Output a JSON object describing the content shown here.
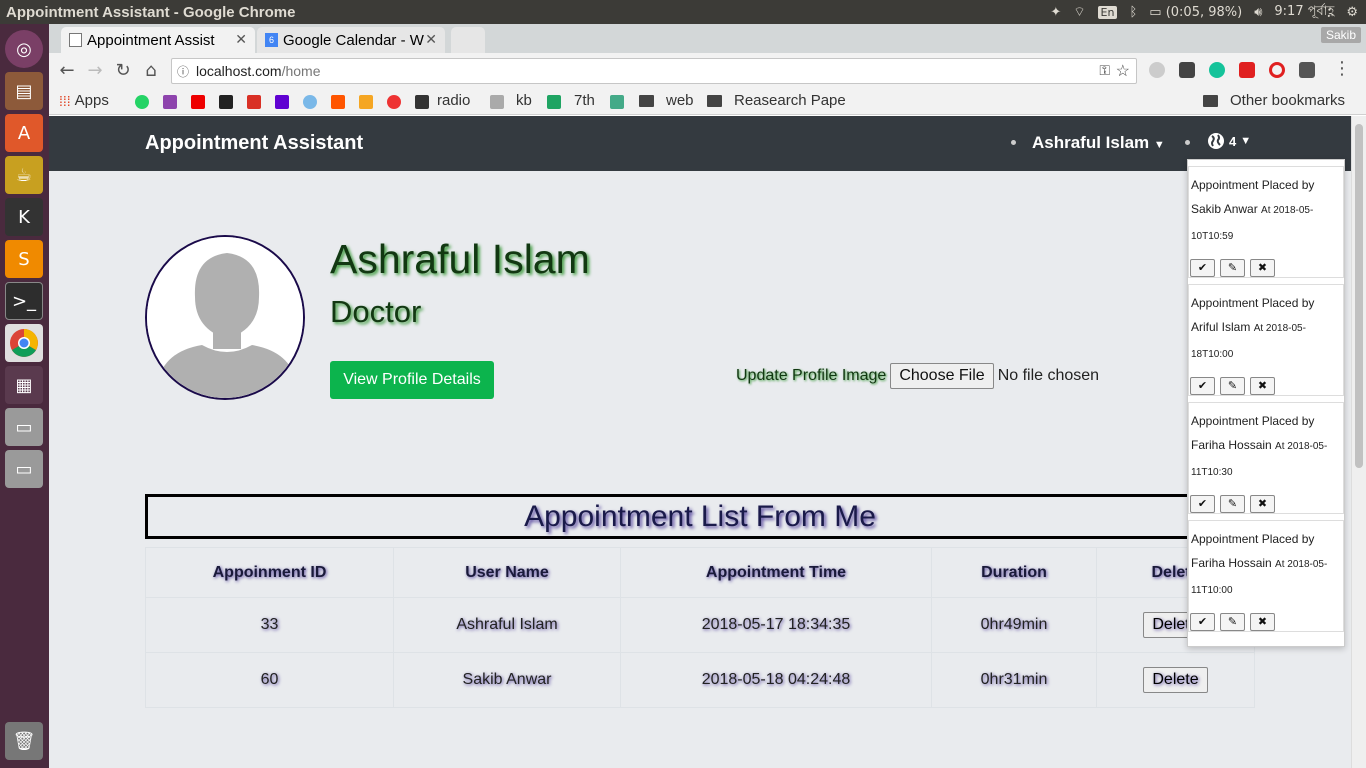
{
  "os": {
    "window_title": "Appointment Assistant - Google Chrome",
    "lang_indicator": "En",
    "battery": "(0:05, 98%)",
    "clock": "9:17 পূর্বাহ্ণ"
  },
  "browser": {
    "tabs": [
      {
        "label": "Appointment Assist"
      },
      {
        "label": "Google Calendar - W"
      }
    ],
    "user_chip": "Sakib",
    "url_host": "localhost.com",
    "url_path": "/home",
    "bookmarks": {
      "apps": "Apps",
      "radio": "radio",
      "kb": "kb",
      "seventh": "7th",
      "web": "web",
      "research": "Reasearch Pape",
      "other": "Other bookmarks"
    }
  },
  "navbar": {
    "brand": "Appointment Assistant",
    "user": "Ashraful Islam",
    "notif_count": "4"
  },
  "profile": {
    "name": "Ashraful Islam",
    "role": "Doctor",
    "view_button": "View Profile Details",
    "upload_label": "Update Profile Image",
    "choose_file": "Choose File",
    "no_file": "No file chosen"
  },
  "appointments": {
    "title": "Appointment List From Me",
    "headers": [
      "Appoinment ID",
      "User Name",
      "Appointment Time",
      "Duration",
      "Delete"
    ],
    "rows": [
      {
        "id": "33",
        "user": "Ashraful Islam",
        "time": "2018-05-17 18:34:35",
        "duration": "0hr49min",
        "action": "Delete"
      },
      {
        "id": "60",
        "user": "Sakib Anwar",
        "time": "2018-05-18 04:24:48",
        "duration": "0hr31min",
        "action": "Delete"
      }
    ]
  },
  "notifications": [
    {
      "text": "Appointment Placed by Sakib Anwar",
      "at": "At 2018-05-10T10:59"
    },
    {
      "text": "Appointment Placed by Ariful Islam",
      "at": "At 2018-05-18T10:00"
    },
    {
      "text": "Appointment Placed by Fariha Hossain",
      "at": "At 2018-05-11T10:30"
    },
    {
      "text": "Appointment Placed by Fariha Hossain",
      "at": "At 2018-05-11T10:00"
    }
  ],
  "colors": {
    "navbar_bg": "#343a40",
    "primary_green": "#0cb44d",
    "page_bg": "#e9ebee",
    "launcher_bg": "#4a2a3e"
  }
}
